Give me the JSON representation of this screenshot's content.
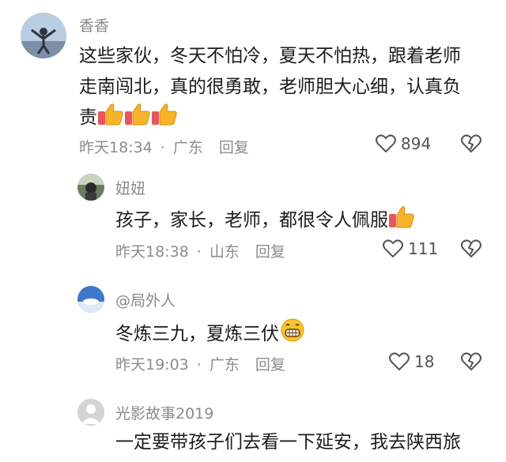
{
  "comments": [
    {
      "author": "香香",
      "text_lines": [
        "这些家伙，冬天不怕冷，夏天不怕热，跟着老师",
        "走南闯北，真的很勇敢，老师胆大心细，认真负",
        "责"
      ],
      "emoji": [
        "thumbs-up-icon",
        "thumbs-up-icon",
        "thumbs-up-icon"
      ],
      "time": "昨天18:34",
      "location": "广东",
      "reply": "回复",
      "likes": "894"
    },
    {
      "author": "妞妞",
      "text": "孩子，家长，老师，都很令人佩服",
      "emoji": [
        "thumbs-up-icon"
      ],
      "time": "昨天18:38",
      "location": "山东",
      "reply": "回复",
      "likes": "111"
    },
    {
      "author": "@局外人",
      "text": "冬炼三九，夏炼三伏",
      "emoji": [
        "grinning-face-icon"
      ],
      "time": "昨天19:03",
      "location": "广东",
      "reply": "回复",
      "likes": "18"
    },
    {
      "author": "光影故事2019",
      "text": "一定要带孩子们去看一下延安，我去陕西旅"
    }
  ],
  "meta_separator": "·"
}
